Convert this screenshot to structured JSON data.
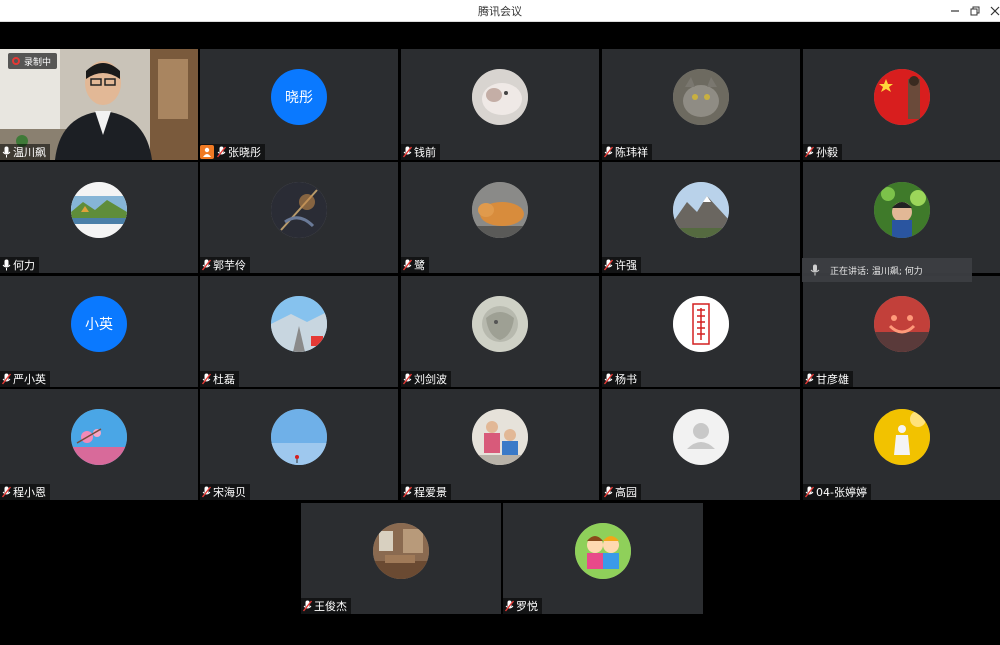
{
  "window": {
    "title": "腾讯会议",
    "minimize_icon": "minimize-icon",
    "restore_icon": "restore-icon",
    "close_icon": "close-icon"
  },
  "recording": {
    "label": "录制中"
  },
  "speaking": {
    "label": "正在讲话: 温川飙; 何力"
  },
  "participants": [
    {
      "name": "温川飙",
      "avatar": "video"
    },
    {
      "name": "张晓彤",
      "avatar": "晓彤",
      "host": true
    },
    {
      "name": "钱前",
      "avatar": "cat-photo"
    },
    {
      "name": "陈玮祥",
      "avatar": "cat-photo"
    },
    {
      "name": "孙毅",
      "avatar": "flag-photo"
    },
    {
      "name": "何力",
      "avatar": "landscape-photo"
    },
    {
      "name": "郭芋伶",
      "avatar": "dark-photo"
    },
    {
      "name": "鹭",
      "avatar": "cat-photo"
    },
    {
      "name": "许强",
      "avatar": "mountain-photo"
    },
    {
      "name": "",
      "avatar": "child-photo"
    },
    {
      "name": "严小英",
      "avatar": "小英"
    },
    {
      "name": "杜磊",
      "avatar": "road-photo"
    },
    {
      "name": "刘剑波",
      "avatar": "sketch-photo"
    },
    {
      "name": "杨书",
      "avatar": "calligraphy-photo"
    },
    {
      "name": "甘彦雄",
      "avatar": "smile-photo"
    },
    {
      "name": "程小恩",
      "avatar": "blossom-photo"
    },
    {
      "name": "宋海贝",
      "avatar": "sky-photo"
    },
    {
      "name": "程爱景",
      "avatar": "kids-photo"
    },
    {
      "name": "高园",
      "avatar": "default-avatar"
    },
    {
      "name": "04-张婷婷",
      "avatar": "yellow-photo"
    },
    {
      "name": "王俊杰",
      "avatar": "room-photo"
    },
    {
      "name": "罗悦",
      "avatar": "cartoon-photo"
    }
  ],
  "colors": {
    "tile_bg": "#2b2d30",
    "avatar_text_bg": "#0a79ff",
    "host_badge": "#f07a24",
    "muted_red": "#e53935"
  }
}
